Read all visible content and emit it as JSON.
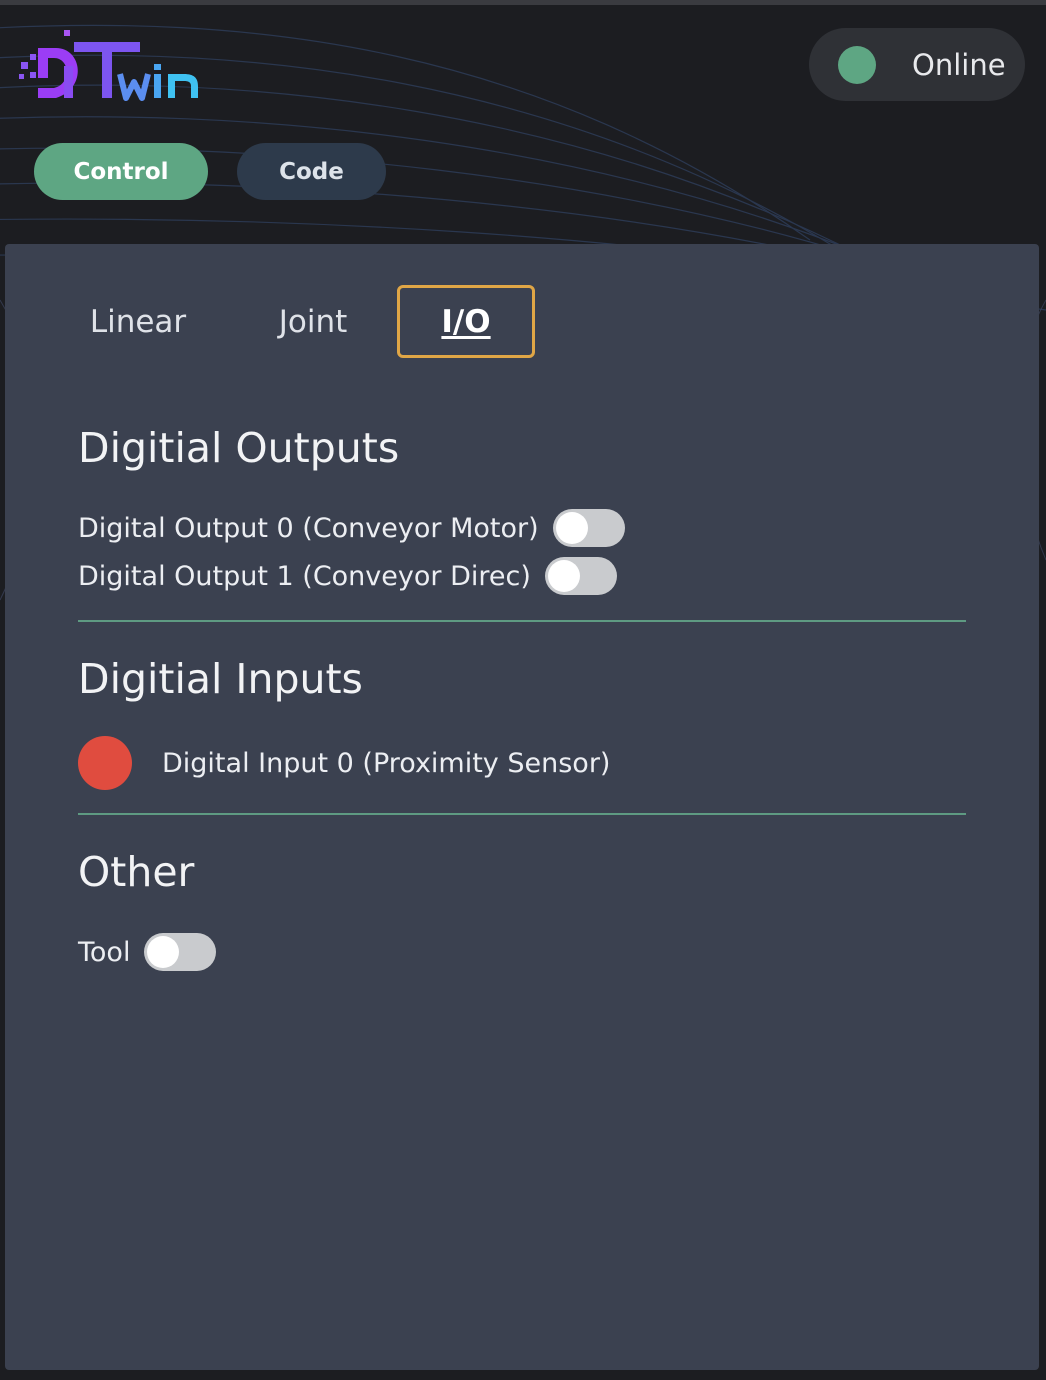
{
  "header": {
    "logo_text": "DiTwin",
    "status": {
      "label": "Online",
      "color": "#5ea683"
    }
  },
  "mode_buttons": {
    "control_label": "Control",
    "code_label": "Code",
    "active": "Control"
  },
  "tabs": [
    {
      "label": "Linear",
      "active": false
    },
    {
      "label": "Joint",
      "active": false
    },
    {
      "label": "I/O",
      "active": true
    }
  ],
  "digital_outputs": {
    "title": "Digitial Outputs",
    "items": [
      {
        "label": "Digital Output 0 (Conveyor Motor)",
        "on": false
      },
      {
        "label": "Digital Output 1 (Conveyor Direc)",
        "on": false
      }
    ]
  },
  "digital_inputs": {
    "title": "Digitial Inputs",
    "items": [
      {
        "label": "Digital Input 0 (Proximity Sensor)",
        "state_color": "#e04c3f"
      }
    ]
  },
  "other": {
    "title": "Other",
    "items": [
      {
        "label": "Tool",
        "on": false
      }
    ]
  },
  "colors": {
    "accent_green": "#5ea683",
    "tab_highlight": "#e0a646",
    "panel_bg": "#3b4150",
    "app_bg": "#1c1d21"
  }
}
